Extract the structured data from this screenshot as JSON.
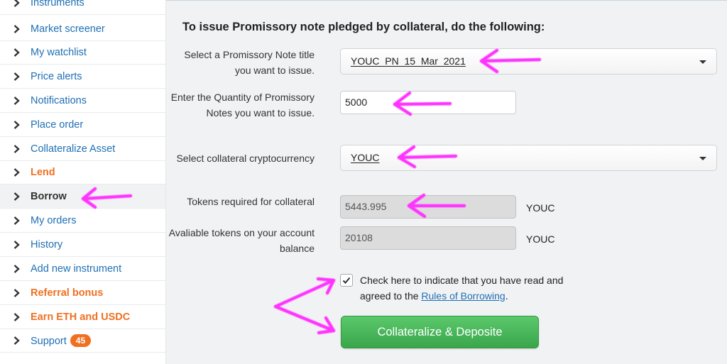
{
  "sidebar": {
    "items": [
      {
        "label": "Instruments",
        "style": "link",
        "active": false
      },
      {
        "label": "Market screener",
        "style": "link",
        "active": false
      },
      {
        "label": "My watchlist",
        "style": "link",
        "active": false
      },
      {
        "label": "Price alerts",
        "style": "link",
        "active": false
      },
      {
        "label": "Notifications",
        "style": "link",
        "active": false
      },
      {
        "label": "Place order",
        "style": "link",
        "active": false
      },
      {
        "label": "Collateralize Asset",
        "style": "link",
        "active": false
      },
      {
        "label": "Lend",
        "style": "orange",
        "active": false
      },
      {
        "label": "Borrow",
        "style": "bold",
        "active": true
      },
      {
        "label": "My orders",
        "style": "link",
        "active": false
      },
      {
        "label": "History",
        "style": "link",
        "active": false
      },
      {
        "label": "Add new instrument",
        "style": "link",
        "active": false
      },
      {
        "label": "Referral bonus",
        "style": "orange",
        "active": false
      },
      {
        "label": "Earn ETH and USDC",
        "style": "orange",
        "active": false
      },
      {
        "label": "Support",
        "style": "link",
        "active": false,
        "badge": "45"
      }
    ]
  },
  "form": {
    "heading": "To issue Promissory note pledged by collateral, do the following:",
    "title_label": "Select a Promissory Note title you want to issue.",
    "title_value": "YOUC_PN_15_Mar_2021",
    "quantity_label": "Enter the Quantity of Promissory Notes you want to issue.",
    "quantity_value": "5000",
    "collateral_label": "Select collateral cryptocurrency",
    "collateral_value": "YOUC",
    "required_label": "Tokens required for collateral",
    "required_value": "5443.995",
    "required_unit": "YOUC",
    "available_label": "Avaliable tokens on your account balance",
    "available_value": "20108",
    "available_unit": "YOUC",
    "agree_text": "Check here to indicate that you have read and agreed to the",
    "agree_link": "Rules of Borrowing",
    "agree_suffix": ".",
    "agree_checked": true,
    "submit_label": "Collateralize & Deposite"
  },
  "colors": {
    "link": "#1f6fb4",
    "orange": "#f07022",
    "button_green": "#46b356",
    "annotation_arrow": "#ff33ff"
  }
}
